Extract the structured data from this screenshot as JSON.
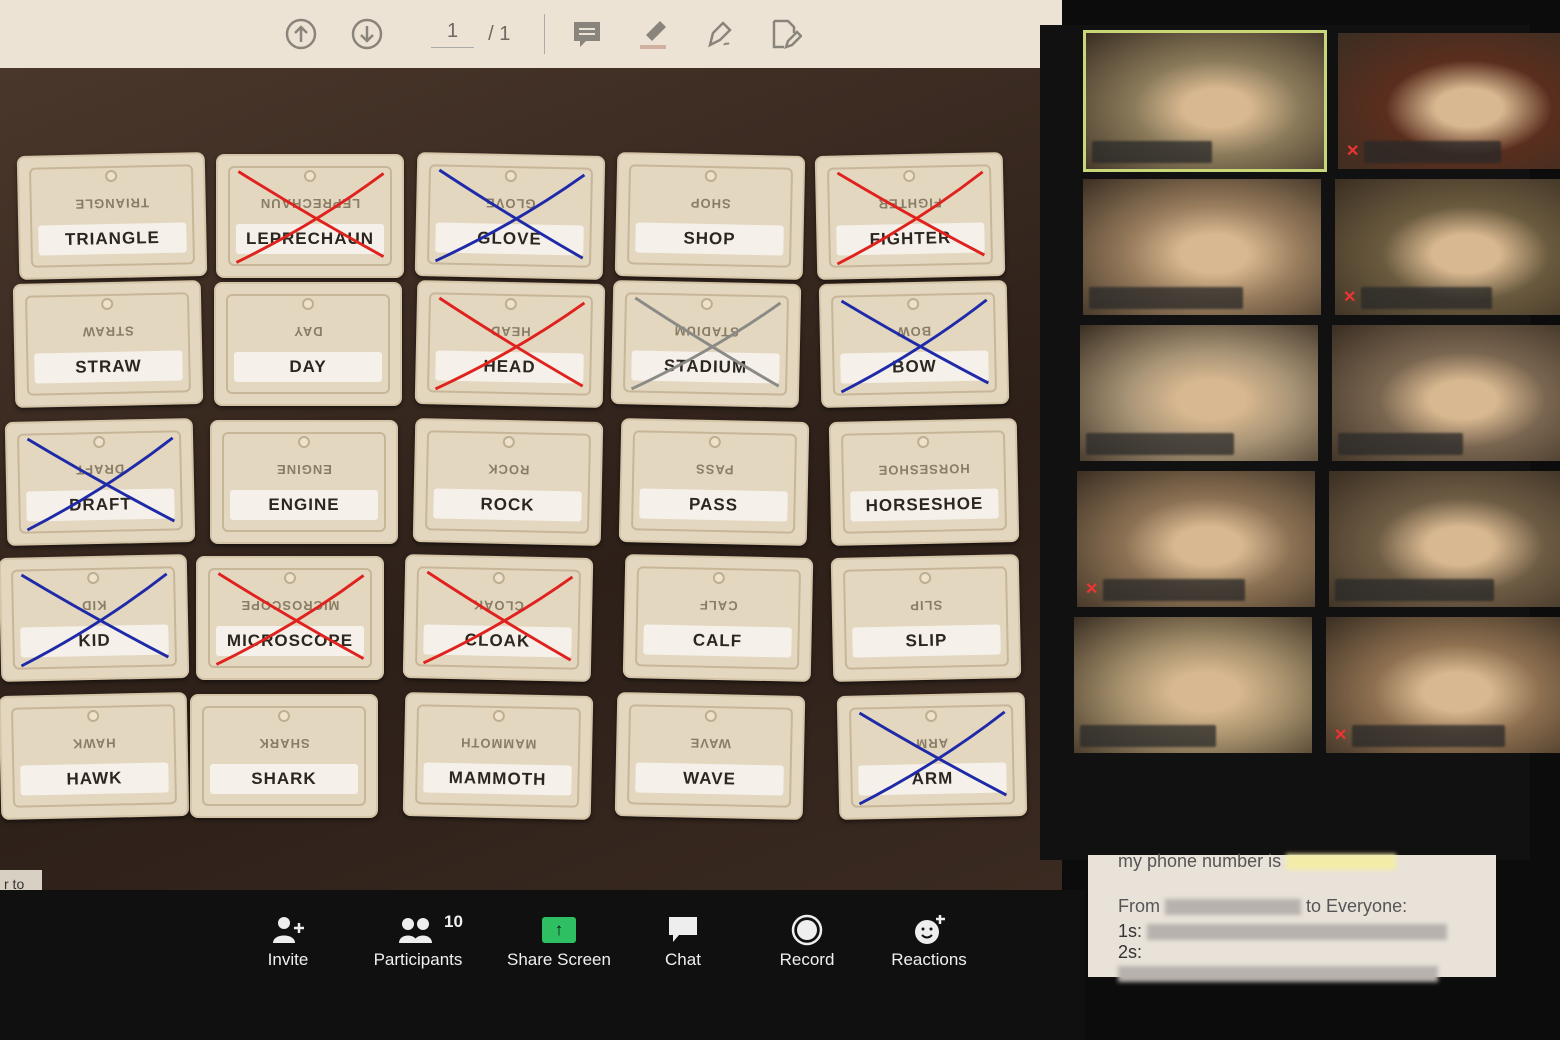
{
  "toolbar": {
    "page_current": "1",
    "page_total": "/ 1",
    "icons": [
      "arrow-up-circle-icon",
      "arrow-down-circle-icon",
      "comment-icon",
      "highlighter-icon",
      "pen-sign-icon",
      "document-edit-icon"
    ]
  },
  "board": {
    "cards": [
      {
        "word": "TRIANGLE"
      },
      {
        "word": "LEPRECHAUN",
        "cross": "#e0221e"
      },
      {
        "word": "GLOVE",
        "cross": "#1e2aa8"
      },
      {
        "word": "SHOP"
      },
      {
        "word": "FIGHTER",
        "cross": "#e0221e"
      },
      {
        "word": "STRAW"
      },
      {
        "word": "DAY"
      },
      {
        "word": "HEAD",
        "cross": "#e0221e"
      },
      {
        "word": "STADIUM",
        "cross": "#8a8a86"
      },
      {
        "word": "BOW",
        "cross": "#1e2aa8"
      },
      {
        "word": "DRAFT",
        "cross": "#1e2aa8"
      },
      {
        "word": "ENGINE"
      },
      {
        "word": "ROCK"
      },
      {
        "word": "PASS"
      },
      {
        "word": "HORSESHOE"
      },
      {
        "word": "KID",
        "cross": "#1e2aa8"
      },
      {
        "word": "MICROSCOPE",
        "cross": "#e0221e"
      },
      {
        "word": "CLOAK",
        "cross": "#e0221e"
      },
      {
        "word": "CALF"
      },
      {
        "word": "SLIP"
      },
      {
        "word": "HAWK"
      },
      {
        "word": "SHARK"
      },
      {
        "word": "MAMMOTH"
      },
      {
        "word": "WAVE"
      },
      {
        "word": "ARM",
        "cross": "#1e2aa8"
      }
    ]
  },
  "videos": {
    "tiles": [
      {
        "bg": "#8a7a5a",
        "active": true
      },
      {
        "bg": "#5a2e1e",
        "muted": true
      },
      {
        "bg": "#9a7e5e"
      },
      {
        "bg": "#6a5a3e",
        "muted": true
      },
      {
        "bg": "#a89476"
      },
      {
        "bg": "#7a6650"
      },
      {
        "bg": "#8c7254",
        "muted": true
      },
      {
        "bg": "#6e5c44"
      },
      {
        "bg": "#a6916c"
      },
      {
        "bg": "#8e7050",
        "muted": true
      }
    ]
  },
  "chat": {
    "line0": "my phone number is",
    "from_label": "From",
    "to_label": "to Everyone:",
    "line1_label": "1s:",
    "line2_label": "2s:"
  },
  "hint_text": "r to",
  "bottombar": {
    "invite": "Invite",
    "participants": "Participants",
    "participants_count": "10",
    "share": "Share Screen",
    "chat": "Chat",
    "record": "Record",
    "reactions": "Reactions",
    "share_color": "#2dbf62"
  }
}
